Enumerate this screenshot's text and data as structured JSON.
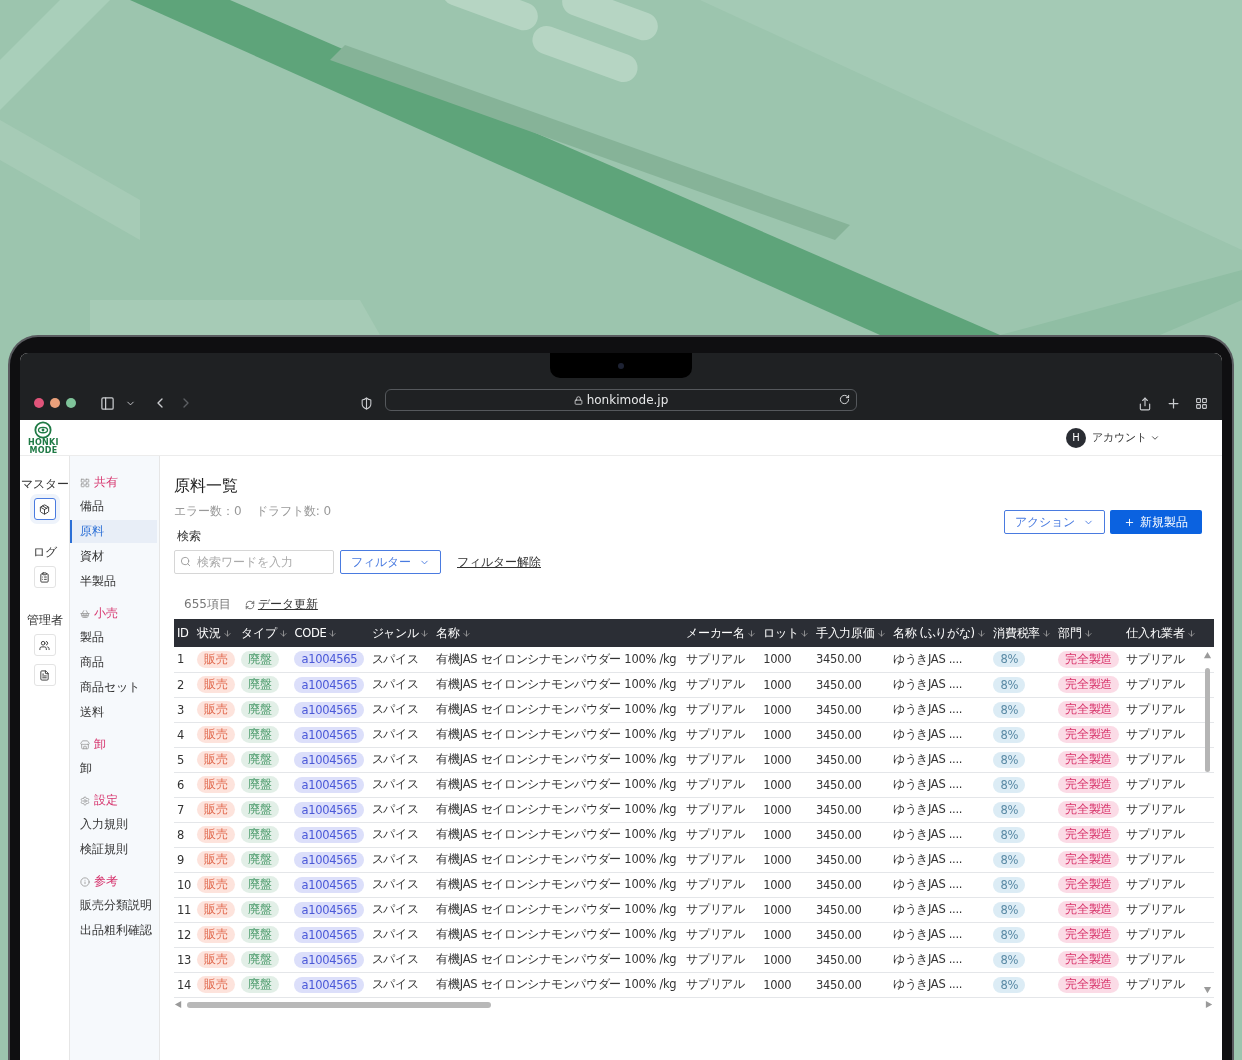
{
  "browser": {
    "url": "honkimode.jp",
    "back_disabled": false,
    "forward_disabled": true
  },
  "logo": {
    "lines": [
      "HONKI",
      "MODE"
    ]
  },
  "account": {
    "avatar": "H",
    "label": "アカウント"
  },
  "rail": [
    {
      "label": "マスター",
      "items": [
        {
          "selected": true
        }
      ]
    },
    {
      "label": "ログ",
      "items": [
        {
          "selected": false
        }
      ]
    },
    {
      "label": "管理者",
      "items": [
        {
          "selected": false
        },
        {
          "selected": false
        }
      ]
    }
  ],
  "nav_groups": [
    {
      "title": "共有",
      "items": [
        {
          "label": "備品",
          "selected": false
        },
        {
          "label": "原料",
          "selected": true
        },
        {
          "label": "資材",
          "selected": false
        },
        {
          "label": "半製品",
          "selected": false
        }
      ]
    },
    {
      "title": "小売",
      "items": [
        {
          "label": "製品",
          "selected": false
        },
        {
          "label": "商品",
          "selected": false
        },
        {
          "label": "商品セット",
          "selected": false
        },
        {
          "label": "送料",
          "selected": false
        }
      ]
    },
    {
      "title": "卸",
      "items": [
        {
          "label": "卸",
          "selected": false
        }
      ]
    },
    {
      "title": "設定",
      "items": [
        {
          "label": "入力規則",
          "selected": false
        },
        {
          "label": "検証規則",
          "selected": false
        }
      ]
    },
    {
      "title": "参考",
      "items": [
        {
          "label": "販売分類説明",
          "selected": false
        },
        {
          "label": "出品粗利確認",
          "selected": false
        }
      ]
    }
  ],
  "page": {
    "title": "原料一覧",
    "stats": [
      "エラー数：0",
      "ドラフト数: 0"
    ],
    "action_menu": "アクション",
    "primary_button": "新規製品"
  },
  "search": {
    "label": "検索",
    "placeholder": "検索ワードを入力",
    "filter": "フィルター",
    "clear": "フィルター解除"
  },
  "summary": {
    "count": "655項目",
    "refresh": "データ更新"
  },
  "table": {
    "columns": [
      {
        "label": "ID",
        "kind": "text",
        "sortable": false
      },
      {
        "label": "状況",
        "kind": "status",
        "sortable": true
      },
      {
        "label": "タイプ",
        "kind": "type",
        "sortable": true
      },
      {
        "label": "CODE",
        "kind": "code",
        "sortable": true
      },
      {
        "label": "ジャンル",
        "kind": "text",
        "sortable": true
      },
      {
        "label": "名称",
        "kind": "text",
        "sortable": true
      },
      {
        "label": "メーカー名",
        "kind": "text",
        "sortable": true
      },
      {
        "label": "ロット",
        "kind": "text",
        "sortable": true
      },
      {
        "label": "手入力原価",
        "kind": "text",
        "sortable": true
      },
      {
        "label": "名称 (ふりがな)",
        "kind": "text",
        "sortable": true
      },
      {
        "label": "消費税率",
        "kind": "tax",
        "sortable": true
      },
      {
        "label": "部門",
        "kind": "dept",
        "sortable": true
      },
      {
        "label": "仕入れ業者",
        "kind": "text",
        "sortable": true
      }
    ],
    "rows": [
      [
        "1",
        "販売",
        "廃盤",
        "a1004565",
        "スパイス",
        "有機JAS セイロンシナモンパウダー 100% /kg",
        "サプリアル",
        "1000",
        "3450.00",
        "ゆうきJAS ....",
        "8%",
        "完全製造",
        "サプリアル"
      ],
      [
        "2",
        "販売",
        "廃盤",
        "a1004565",
        "スパイス",
        "有機JAS セイロンシナモンパウダー 100% /kg",
        "サプリアル",
        "1000",
        "3450.00",
        "ゆうきJAS ....",
        "8%",
        "完全製造",
        "サプリアル"
      ],
      [
        "3",
        "販売",
        "廃盤",
        "a1004565",
        "スパイス",
        "有機JAS セイロンシナモンパウダー 100% /kg",
        "サプリアル",
        "1000",
        "3450.00",
        "ゆうきJAS ....",
        "8%",
        "完全製造",
        "サプリアル"
      ],
      [
        "4",
        "販売",
        "廃盤",
        "a1004565",
        "スパイス",
        "有機JAS セイロンシナモンパウダー 100% /kg",
        "サプリアル",
        "1000",
        "3450.00",
        "ゆうきJAS ....",
        "8%",
        "完全製造",
        "サプリアル"
      ],
      [
        "5",
        "販売",
        "廃盤",
        "a1004565",
        "スパイス",
        "有機JAS セイロンシナモンパウダー 100% /kg",
        "サプリアル",
        "1000",
        "3450.00",
        "ゆうきJAS ....",
        "8%",
        "完全製造",
        "サプリアル"
      ],
      [
        "6",
        "販売",
        "廃盤",
        "a1004565",
        "スパイス",
        "有機JAS セイロンシナモンパウダー 100% /kg",
        "サプリアル",
        "1000",
        "3450.00",
        "ゆうきJAS ....",
        "8%",
        "完全製造",
        "サプリアル"
      ],
      [
        "7",
        "販売",
        "廃盤",
        "a1004565",
        "スパイス",
        "有機JAS セイロンシナモンパウダー 100% /kg",
        "サプリアル",
        "1000",
        "3450.00",
        "ゆうきJAS ....",
        "8%",
        "完全製造",
        "サプリアル"
      ],
      [
        "8",
        "販売",
        "廃盤",
        "a1004565",
        "スパイス",
        "有機JAS セイロンシナモンパウダー 100% /kg",
        "サプリアル",
        "1000",
        "3450.00",
        "ゆうきJAS ....",
        "8%",
        "完全製造",
        "サプリアル"
      ],
      [
        "9",
        "販売",
        "廃盤",
        "a1004565",
        "スパイス",
        "有機JAS セイロンシナモンパウダー 100% /kg",
        "サプリアル",
        "1000",
        "3450.00",
        "ゆうきJAS ....",
        "8%",
        "完全製造",
        "サプリアル"
      ],
      [
        "10",
        "販売",
        "廃盤",
        "a1004565",
        "スパイス",
        "有機JAS セイロンシナモンパウダー 100% /kg",
        "サプリアル",
        "1000",
        "3450.00",
        "ゆうきJAS ....",
        "8%",
        "完全製造",
        "サプリアル"
      ],
      [
        "11",
        "販売",
        "廃盤",
        "a1004565",
        "スパイス",
        "有機JAS セイロンシナモンパウダー 100% /kg",
        "サプリアル",
        "1000",
        "3450.00",
        "ゆうきJAS ....",
        "8%",
        "完全製造",
        "サプリアル"
      ],
      [
        "12",
        "販売",
        "廃盤",
        "a1004565",
        "スパイス",
        "有機JAS セイロンシナモンパウダー 100% /kg",
        "サプリアル",
        "1000",
        "3450.00",
        "ゆうきJAS ....",
        "8%",
        "完全製造",
        "サプリアル"
      ],
      [
        "13",
        "販売",
        "廃盤",
        "a1004565",
        "スパイス",
        "有機JAS セイロンシナモンパウダー 100% /kg",
        "サプリアル",
        "1000",
        "3450.00",
        "ゆうきJAS ....",
        "8%",
        "完全製造",
        "サプリアル"
      ],
      [
        "14",
        "販売",
        "廃盤",
        "a1004565",
        "スパイス",
        "有機JAS セイロンシナモンパウダー 100% /kg",
        "サプリアル",
        "1000",
        "3450.00",
        "ゆうきJAS ....",
        "8%",
        "完全製造",
        "サプリアル"
      ]
    ]
  }
}
